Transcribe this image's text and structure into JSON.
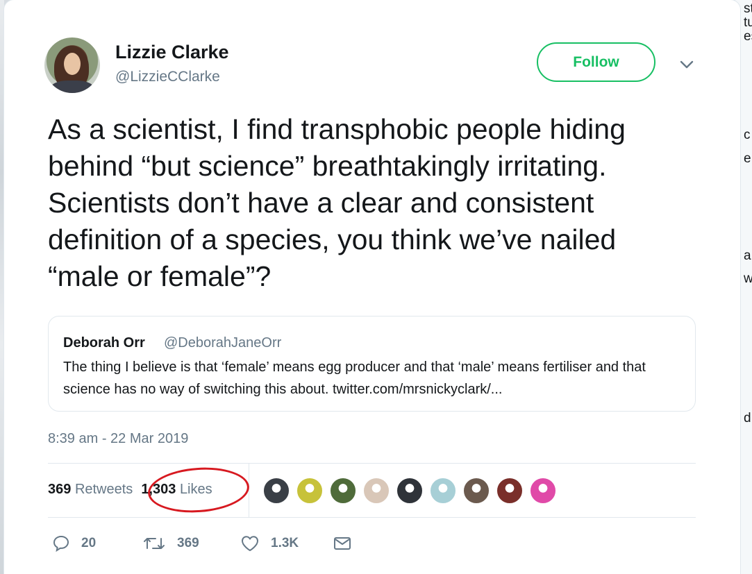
{
  "background_peek": {
    "right_fragments": [
      "st",
      "tu",
      "es",
      "c",
      "e",
      "a",
      "w",
      "d"
    ]
  },
  "tweet": {
    "author_name": "Lizzie Clarke",
    "author_handle": "@LizzieCClarke",
    "follow_label": "Follow",
    "text": "As a scientist, I find transphobic people hiding behind “but science” breathtakingly irritating. Scientists don’t have a clear and consistent definition of a species, you think we’ve nailed “male or female”?",
    "quoted": {
      "author_name": "Deborah Orr",
      "author_handle": "@DeborahJaneOrr",
      "text": "The thing I believe is that ‘female’ means egg producer and that ‘male’ means fertiliser and that science has no way of switching this about. twitter.com/mrsnickyclark/..."
    },
    "timestamp": "8:39 am - 22 Mar 2019",
    "stats": {
      "retweets_count": "369",
      "retweets_label": "Retweets",
      "likes_count": "1,303",
      "likes_label": "Likes"
    },
    "liker_avatar_colors": [
      "#3a3f46",
      "#c7c23a",
      "#4f6b3a",
      "#d9c7b8",
      "#2f3339",
      "#a7cfd6",
      "#6b5a4e",
      "#7a2f2a",
      "#e04aa8"
    ],
    "actions": {
      "reply_count": "20",
      "retweet_count": "369",
      "like_count": "1.3K"
    },
    "colors": {
      "follow_green": "#17bf63",
      "secondary_text": "#657786",
      "annotation_red": "#d71920"
    }
  }
}
